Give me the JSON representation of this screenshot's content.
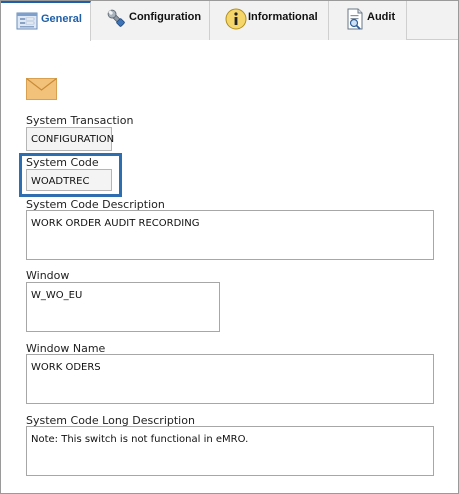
{
  "tabs": [
    {
      "label": "General",
      "icon": "general-form-icon",
      "active": true
    },
    {
      "label": "Configuration",
      "icon": "wrench-icon",
      "active": false
    },
    {
      "label": "Informational",
      "icon": "info-icon",
      "active": false
    },
    {
      "label": "Audit",
      "icon": "audit-document-icon",
      "active": false
    }
  ],
  "header_icon": "envelope-icon",
  "fields": {
    "system_transaction": {
      "label": "System Transaction",
      "value": "CONFIGURATION"
    },
    "system_code": {
      "label": "System Code",
      "value": "WOADTREC"
    },
    "system_code_description": {
      "label": "System Code Description",
      "value": "WORK ORDER AUDIT RECORDING"
    },
    "window": {
      "label": "Window",
      "value": "W_WO_EU"
    },
    "window_name": {
      "label": "Window Name",
      "value": "WORK ODERS"
    },
    "system_code_long_description": {
      "label": "System Code Long Description",
      "value": "Note: This switch is not functional in eMRO."
    }
  },
  "colors": {
    "accent": "#1f5fa8",
    "highlight": "#2d6db0",
    "envelope": "#f3c27a"
  }
}
